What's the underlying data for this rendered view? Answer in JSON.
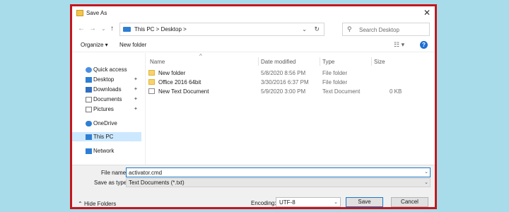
{
  "window": {
    "title": "Save As"
  },
  "address": {
    "crumbs": "This PC  >  Desktop  >"
  },
  "search": {
    "placeholder": "Search Desktop"
  },
  "toolbar": {
    "organize": "Organize ▾",
    "new_folder": "New folder"
  },
  "nav": [
    {
      "label": "Quick access",
      "icon": "star-icon",
      "pinned": false,
      "selected": false
    },
    {
      "label": "Desktop",
      "icon": "desktop-icon",
      "pinned": true,
      "selected": false
    },
    {
      "label": "Downloads",
      "icon": "download-icon",
      "pinned": true,
      "selected": false
    },
    {
      "label": "Documents",
      "icon": "documents-icon",
      "pinned": true,
      "selected": false
    },
    {
      "label": "Pictures",
      "icon": "pictures-icon",
      "pinned": true,
      "selected": false
    },
    {
      "label": "OneDrive",
      "icon": "cloud-icon",
      "pinned": false,
      "selected": false
    },
    {
      "label": "This PC",
      "icon": "computer-icon",
      "pinned": false,
      "selected": true
    },
    {
      "label": "Network",
      "icon": "network-icon",
      "pinned": false,
      "selected": false
    }
  ],
  "columns": {
    "name": "Name",
    "date": "Date modified",
    "type": "Type",
    "size": "Size"
  },
  "files": [
    {
      "name": "New folder",
      "date": "5/8/2020 8:56 PM",
      "type": "File folder",
      "size": "",
      "kind": "folder"
    },
    {
      "name": "Office 2016 64bit",
      "date": "3/30/2016 6:37 PM",
      "type": "File folder",
      "size": "",
      "kind": "folder"
    },
    {
      "name": "New Text Document",
      "date": "5/9/2020 3:00 PM",
      "type": "Text Document",
      "size": "0 KB",
      "kind": "doc"
    }
  ],
  "bottom": {
    "filename_label": "File name:",
    "filename_value": "activator.cmd",
    "savetype_label": "Save as type:",
    "savetype_value": "Text Documents (*.txt)",
    "hide_folders": "Hide Folders",
    "encoding_label": "Encoding:",
    "encoding_value": "UTF-8",
    "save": "Save",
    "cancel": "Cancel"
  },
  "colors": {
    "frame": "#c4171d",
    "background": "#a9dcea",
    "accent": "#1e78c8",
    "selection": "#cce8ff"
  }
}
